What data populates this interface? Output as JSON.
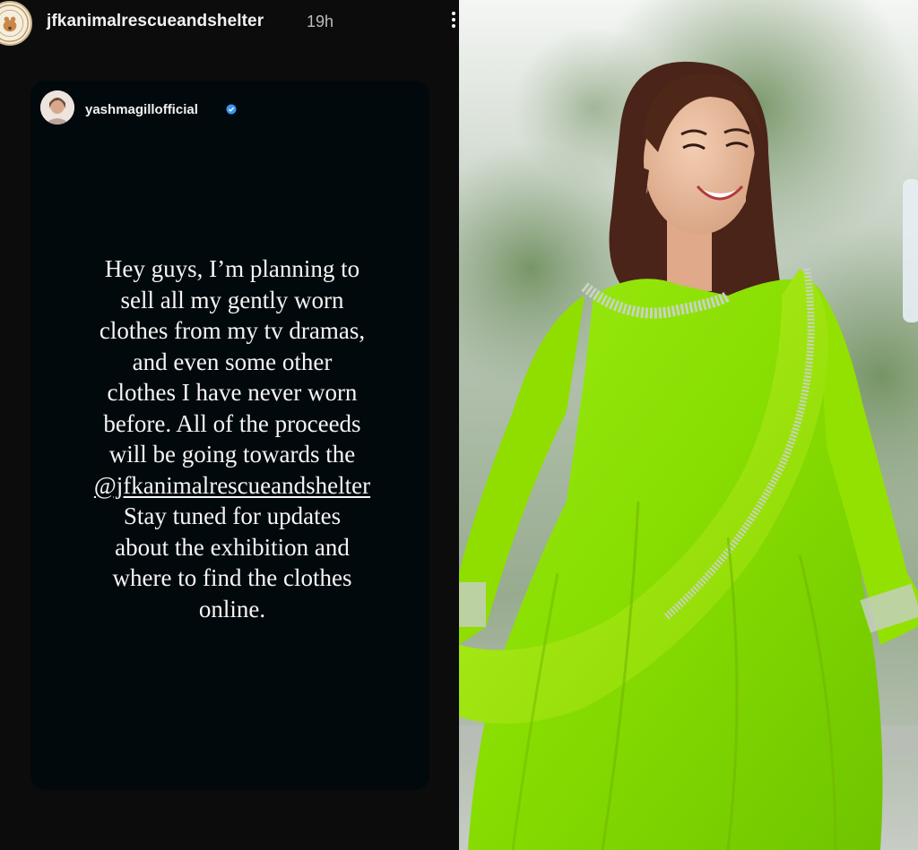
{
  "story": {
    "username": "jfkanimalrescueandshelter",
    "time": "19h",
    "avatar_icon": "shelter-logo-icon",
    "more_icon": "more-vertical-icon"
  },
  "shared_story": {
    "username": "yashmagillofficial",
    "verified_icon": "verified-badge-icon",
    "message_lines": [
      "Hey guys, I’m planning to",
      "sell all my gently worn",
      "clothes from my tv dramas,",
      "and even some other",
      "clothes I have never worn",
      "before. All of the proceeds",
      "will be going towards the"
    ],
    "mention": "@jfkanimalrescueandshelter",
    "message_lines_after": [
      "Stay tuned for updates",
      "about the exhibition and",
      "where to find the clothes",
      "online."
    ]
  },
  "colors": {
    "story_bg": "#0c0c0c",
    "card_bg": "#02090d",
    "verified_blue": "#3897f0",
    "dress_green": "#8ee000"
  }
}
